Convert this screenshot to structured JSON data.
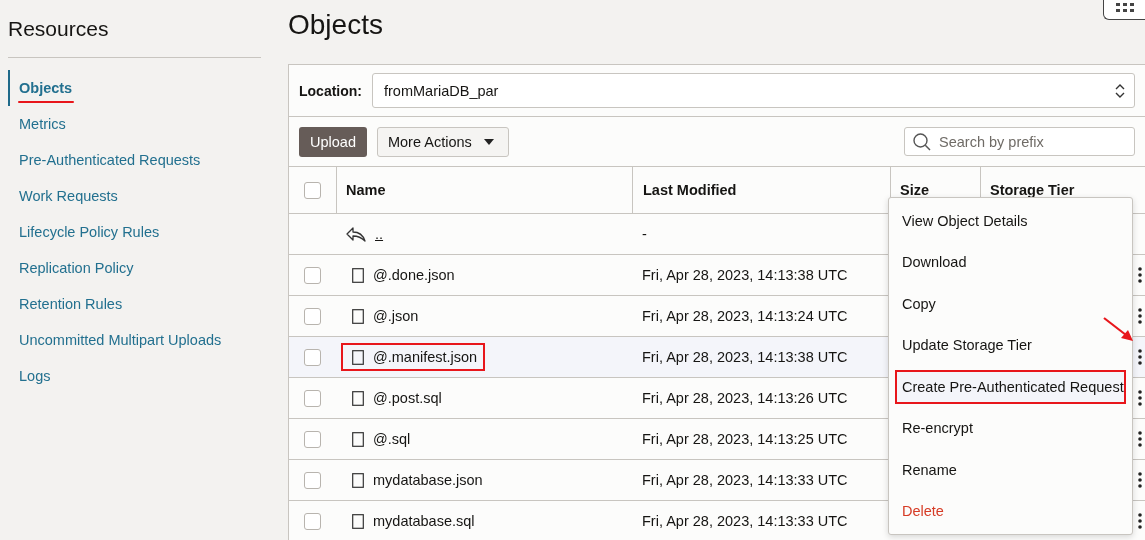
{
  "sidebar": {
    "title": "Resources",
    "items": [
      {
        "label": "Objects",
        "selected": true,
        "annotated": true
      },
      {
        "label": "Metrics",
        "selected": false,
        "annotated": false
      },
      {
        "label": "Pre-Authenticated Requests",
        "selected": false,
        "annotated": false
      },
      {
        "label": "Work Requests",
        "selected": false,
        "annotated": false
      },
      {
        "label": "Lifecycle Policy Rules",
        "selected": false,
        "annotated": false
      },
      {
        "label": "Replication Policy",
        "selected": false,
        "annotated": false
      },
      {
        "label": "Retention Rules",
        "selected": false,
        "annotated": false
      },
      {
        "label": "Uncommitted Multipart Uploads",
        "selected": false,
        "annotated": false
      },
      {
        "label": "Logs",
        "selected": false,
        "annotated": false
      }
    ]
  },
  "page_title": "Objects",
  "location": {
    "label": "Location:",
    "value": "fromMariaDB_par"
  },
  "toolbar": {
    "upload": "Upload",
    "more_actions": "More Actions",
    "search": {
      "placeholder": "Search by prefix"
    }
  },
  "table": {
    "all_checked": false,
    "columns": [
      "Name",
      "Last Modified",
      "Size",
      "Storage Tier"
    ],
    "rows": [
      {
        "kind": "parent",
        "name": "..",
        "modified": "-",
        "selected": false
      },
      {
        "kind": "file",
        "name": "@.done.json",
        "modified": "Fri, Apr 28, 2023, 14:13:38 UTC",
        "selected": false,
        "annotated": false
      },
      {
        "kind": "file",
        "name": "@.json",
        "modified": "Fri, Apr 28, 2023, 14:13:24 UTC",
        "selected": false,
        "annotated": false
      },
      {
        "kind": "file",
        "name": "@.manifest.json",
        "modified": "Fri, Apr 28, 2023, 14:13:38 UTC",
        "selected": true,
        "annotated": true
      },
      {
        "kind": "file",
        "name": "@.post.sql",
        "modified": "Fri, Apr 28, 2023, 14:13:26 UTC",
        "selected": false,
        "annotated": false
      },
      {
        "kind": "file",
        "name": "@.sql",
        "modified": "Fri, Apr 28, 2023, 14:13:25 UTC",
        "selected": false,
        "annotated": false
      },
      {
        "kind": "file",
        "name": "mydatabase.json",
        "modified": "Fri, Apr 28, 2023, 14:13:33 UTC",
        "selected": false,
        "annotated": false
      },
      {
        "kind": "file",
        "name": "mydatabase.sql",
        "modified": "Fri, Apr 28, 2023, 14:13:33 UTC",
        "selected": false,
        "annotated": false
      }
    ]
  },
  "context_menu": {
    "items": [
      {
        "label": "View Object Details",
        "kind": "normal",
        "annotated": false
      },
      {
        "label": "Download",
        "kind": "normal",
        "annotated": false
      },
      {
        "label": "Copy",
        "kind": "normal",
        "annotated": false
      },
      {
        "label": "Update Storage Tier",
        "kind": "normal",
        "annotated": false
      },
      {
        "label": "Create Pre-Authenticated Request",
        "kind": "normal",
        "annotated": true
      },
      {
        "label": "Re-encrypt",
        "kind": "normal",
        "annotated": false
      },
      {
        "label": "Rename",
        "kind": "normal",
        "annotated": false
      },
      {
        "label": "Delete",
        "kind": "danger",
        "annotated": false
      }
    ]
  }
}
